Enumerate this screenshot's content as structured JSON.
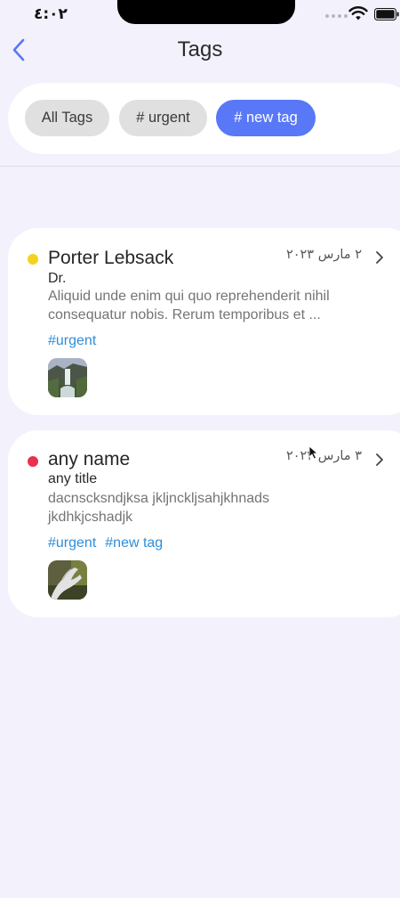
{
  "status_bar": {
    "time": "٤:٠٢"
  },
  "header": {
    "title": "Tags"
  },
  "tag_filters": [
    {
      "label": "All Tags",
      "active": false
    },
    {
      "label": "# urgent",
      "active": false
    },
    {
      "label": "# new tag",
      "active": true
    }
  ],
  "notes": [
    {
      "name": "Porter Lebsack",
      "date": "٢ مارس ٢٠٢٣",
      "title": "Dr.",
      "body": "Aliquid unde enim qui quo reprehenderit nihil consequatur nobis. Rerum temporibus et ...",
      "tags": [
        "#urgent"
      ],
      "dot_color": "#f5d21e",
      "thumbnail": "waterfall-photo"
    },
    {
      "name": "any name",
      "date": "٣ مارس ٢٠٢٣",
      "title": "any title",
      "body": "dacnscksndjksa jkljnckljsahjkhnads jkdhkjcshadjk",
      "tags": [
        "#urgent",
        "#new tag"
      ],
      "dot_color": "#e8314f",
      "thumbnail": "hand-photo"
    }
  ],
  "colors": {
    "background": "#f3f1fb",
    "accent": "#5878f7",
    "tag_link": "#2f8ed9",
    "back_chevron": "#5878f7"
  }
}
